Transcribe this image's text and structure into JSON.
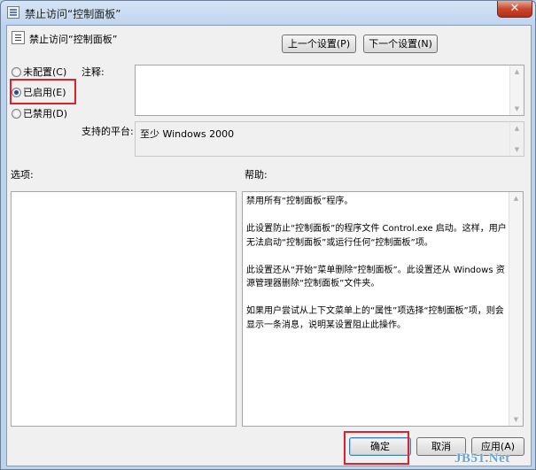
{
  "window": {
    "title": "禁止访问“控制面板”",
    "close_label": "✕"
  },
  "header": {
    "policy_name": "禁止访问“控制面板”",
    "prev_button": "上一个设置(P)",
    "next_button": "下一个设置(N)"
  },
  "state": {
    "not_configured": "未配置(C)",
    "enabled": "已启用(E)",
    "disabled": "已禁用(D)",
    "selected": "enabled"
  },
  "comment": {
    "label": "注释:",
    "value": ""
  },
  "supported": {
    "label": "支持的平台:",
    "value": "至少 Windows 2000"
  },
  "options": {
    "label": "选项:"
  },
  "help": {
    "label": "帮助:",
    "paragraphs": [
      "禁用所有“控制面板”程序。",
      "此设置防止“控制面板”的程序文件 Control.exe 启动。这样，用户无法启动“控制面板”或运行任何“控制面板”项。",
      "此设置还从“开始”菜单删除“控制面板”。此设置还从 Windows 资源管理器删除“控制面板”文件夹。",
      "如果用户尝试从上下文菜单上的“属性”项选择“控制面板”项，则会显示一条消息，说明某设置阻止此操作。"
    ]
  },
  "footer": {
    "ok": "确定",
    "cancel": "取消",
    "apply": "应用(A)"
  },
  "watermark": "JB51.Net",
  "colors": {
    "highlight": "#e0212b",
    "radio_dot": "#1f4e96"
  }
}
